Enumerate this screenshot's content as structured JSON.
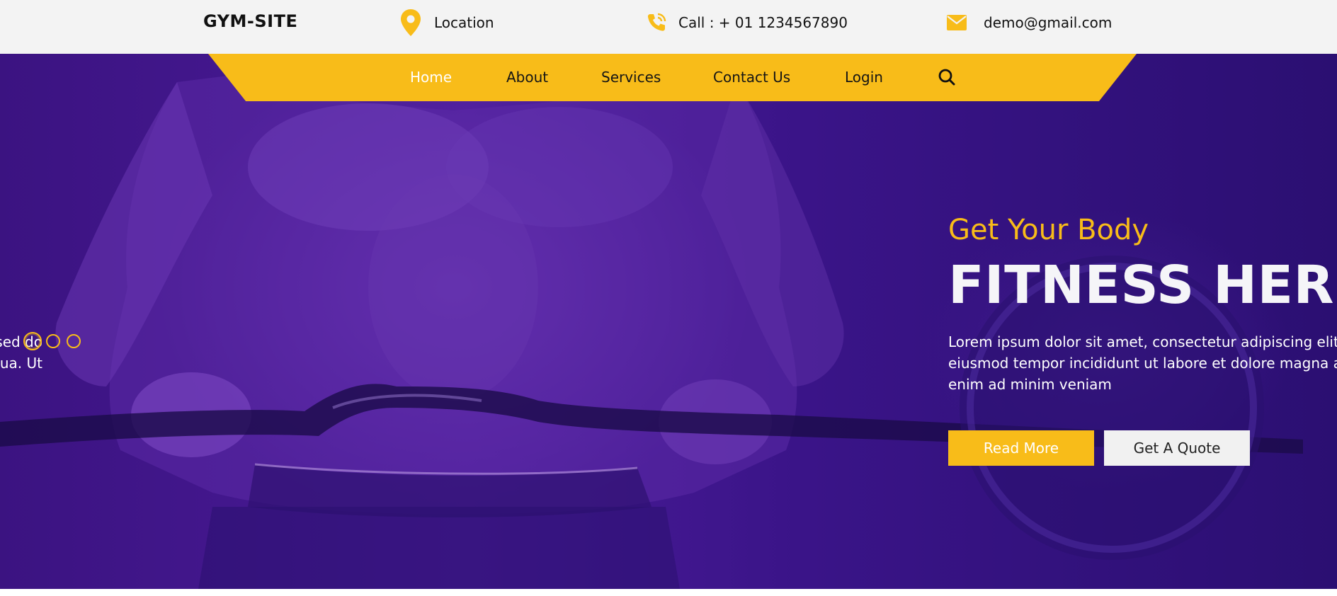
{
  "brand": {
    "name": "GYM-SITE"
  },
  "contact": {
    "location": {
      "icon": "map-pin-icon",
      "label": "Location"
    },
    "phone": {
      "icon": "phone-icon",
      "label": "Call : + 01 1234567890"
    },
    "email": {
      "icon": "envelope-icon",
      "label": "demo@gmail.com"
    }
  },
  "nav": {
    "items": [
      {
        "label": "Home",
        "active": true
      },
      {
        "label": "About"
      },
      {
        "label": "Services"
      },
      {
        "label": "Contact Us"
      },
      {
        "label": "Login"
      }
    ],
    "search_icon": "search-icon"
  },
  "hero": {
    "kicker": "Get Your Body",
    "headline": "FITNESS HERE",
    "lead_lines": [
      "Lorem ipsum dolor sit amet, consectetur adipiscing elit,",
      "eiusmod tempor incididunt ut labore et dolore magna a",
      "enim ad minim veniam"
    ],
    "primary_button": "Read More",
    "secondary_button": "Get A Quote",
    "prev_slide_lines": [
      "sed do",
      "liqua. Ut"
    ]
  },
  "carousel": {
    "slides": 3,
    "active_index": 0
  },
  "colors": {
    "accent": "#f8bc19",
    "hero_overlay": "#3b1381",
    "topbar_bg": "#f3f3f3"
  }
}
